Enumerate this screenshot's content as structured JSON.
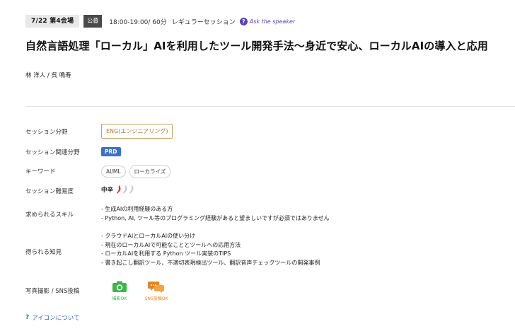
{
  "header": {
    "date_hall": "7/22 第4会場",
    "public_tag": "公募",
    "time": "18:00-19:00/ 60分",
    "session_type": "レギュラーセッション",
    "ask_speaker": "Ask the speaker"
  },
  "title": "自然言語処理「ローカル」AIを利用したツール開発手法〜身近で安心、ローカルAIの導入と応用",
  "speakers": "林 洋人 / 呉 鳴寿",
  "details": {
    "session_category": {
      "label": "セッション分野",
      "value": "ENG(エンジニアリング)"
    },
    "related_category": {
      "label": "セッション関連分野",
      "value": "PRD"
    },
    "keywords": {
      "label": "キーワード",
      "items": [
        "AI/ML",
        "ローカライズ"
      ]
    },
    "difficulty": {
      "label": "セッション難易度",
      "value": "中辛",
      "level": 1,
      "max": 3,
      "active_color": "#e0302a",
      "inactive_color": "#c8c8c8"
    },
    "required_skills": {
      "label": "求められるスキル",
      "items": [
        "- 生成AIの利用経験のある方",
        "- Python, AI, ツール等のプログラミング経験があると望ましいですが必須ではありません"
      ]
    },
    "takeaways": {
      "label": "得られる知見",
      "items": [
        "- クラウドAIとローカルAIの使い分け",
        "- 現在のローカルAIで可能なこととツールへの応用方法",
        "- ローカルAIを利用する Python ツール実装のTIPS",
        "- 書き起こし翻訳ツール、不適切表現検出ツール、翻訳音声チェックツールの開発事例"
      ]
    },
    "photo_sns": {
      "label": "写真撮影 / SNS投稿",
      "photo": {
        "caption": "撮影OK",
        "color": "#3cb54a"
      },
      "sns": {
        "caption": "SNS投稿OK",
        "color": "#e8841e"
      }
    }
  },
  "footer": {
    "about_icons": "アイコンについて"
  }
}
